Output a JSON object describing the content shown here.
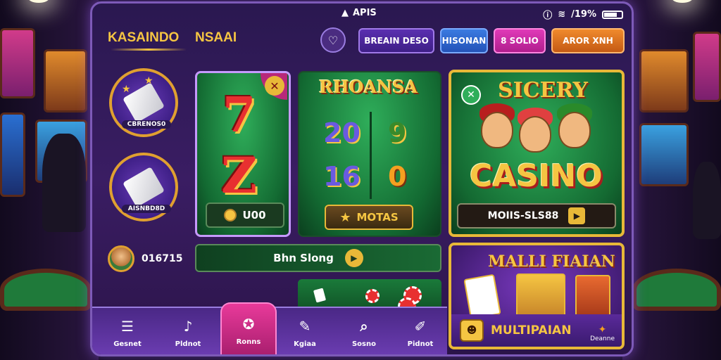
{
  "status": {
    "network": "APIS",
    "battery_text": "/19%"
  },
  "header": {
    "brand": "KASAINDO",
    "brand_secondary": "NSAAI",
    "buttons": [
      {
        "label": "BREAIN DESO"
      },
      {
        "label": "HISONAN"
      },
      {
        "label": "8 SOLIO"
      },
      {
        "label": "AROR XNH"
      }
    ]
  },
  "sidebar": {
    "badges": [
      {
        "label": "CBRENOS0"
      },
      {
        "label": "AISNBD8D"
      }
    ],
    "profile_label": "016715"
  },
  "games": {
    "slots": {
      "symbols": [
        "7",
        "Z"
      ],
      "button_label": "U00"
    },
    "rhoansa": {
      "title": "RHOANSA",
      "reels": [
        "20",
        "9",
        "16",
        "0"
      ],
      "button_label": "MOTAS"
    },
    "casino": {
      "title": "SICERY",
      "word": "CASINO",
      "button_label": "MOIIS-SLS88"
    },
    "banner": {
      "label": "Bhn Slong"
    },
    "multi": {
      "title": "MALLI FIAIAN",
      "button_label": "MULTIPAIAN",
      "side_label": "Deanne"
    }
  },
  "bottom_nav": [
    {
      "label": "Gesnet",
      "icon": "list-icon"
    },
    {
      "label": "Pldnot",
      "icon": "trumpet-icon"
    },
    {
      "label": "Ronns",
      "icon": "chip-icon",
      "active": true
    },
    {
      "label": "Kgiaa",
      "icon": "pencil-icon"
    },
    {
      "label": "Sosno",
      "icon": "search-icon"
    },
    {
      "label": "Pidnot",
      "icon": "edit-icon"
    }
  ],
  "colors": {
    "accent_gold": "#f5c542",
    "frame_purple": "#7d5ab8",
    "active_pink": "#e83a9a"
  }
}
